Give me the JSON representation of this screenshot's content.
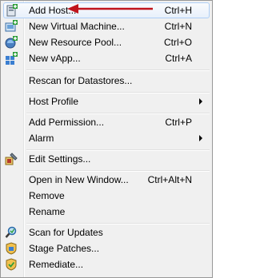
{
  "menu": {
    "items": [
      {
        "label": "Add Host...",
        "shortcut": "Ctrl+H",
        "icon": "add-host-icon"
      },
      {
        "label": "New Virtual Machine...",
        "shortcut": "Ctrl+N",
        "icon": "new-vm-icon"
      },
      {
        "label": "New Resource Pool...",
        "shortcut": "Ctrl+O",
        "icon": "resource-pool-icon"
      },
      {
        "label": "New vApp...",
        "shortcut": "Ctrl+A",
        "icon": "vapp-icon"
      },
      {
        "label": "Rescan for Datastores..."
      },
      {
        "label": "Host Profile",
        "submenu": true
      },
      {
        "label": "Add Permission...",
        "shortcut": "Ctrl+P"
      },
      {
        "label": "Alarm",
        "submenu": true
      },
      {
        "label": "Edit Settings...",
        "icon": "edit-settings-icon"
      },
      {
        "label": "Open in New Window...",
        "shortcut": "Ctrl+Alt+N"
      },
      {
        "label": "Remove"
      },
      {
        "label": "Rename"
      },
      {
        "label": "Scan for Updates",
        "icon": "scan-updates-icon"
      },
      {
        "label": "Stage Patches...",
        "icon": "stage-patches-icon"
      },
      {
        "label": "Remediate...",
        "icon": "remediate-icon"
      }
    ]
  },
  "annotation": {
    "arrow_color": "#c0141b"
  }
}
